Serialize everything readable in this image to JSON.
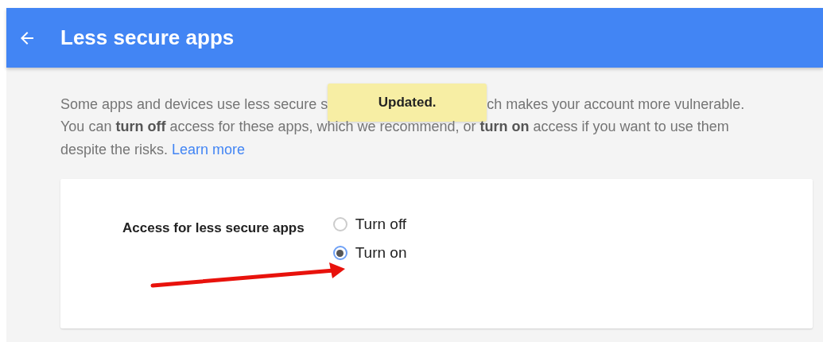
{
  "header": {
    "title": "Less secure apps"
  },
  "toast": {
    "text": "Updated."
  },
  "intro": {
    "line_start": "Some apps and devices use less secure s",
    "line_end": "ch makes your account more vulnerable.",
    "rest": "You can **turn off** access for these apps, which we recommend, or **turn on** access if you want to use them despite the risks.",
    "link": "Learn more"
  },
  "setting": {
    "label": "Access for less secure apps",
    "options": [
      {
        "label": "Turn off",
        "selected": false
      },
      {
        "label": "Turn on",
        "selected": true
      }
    ]
  }
}
